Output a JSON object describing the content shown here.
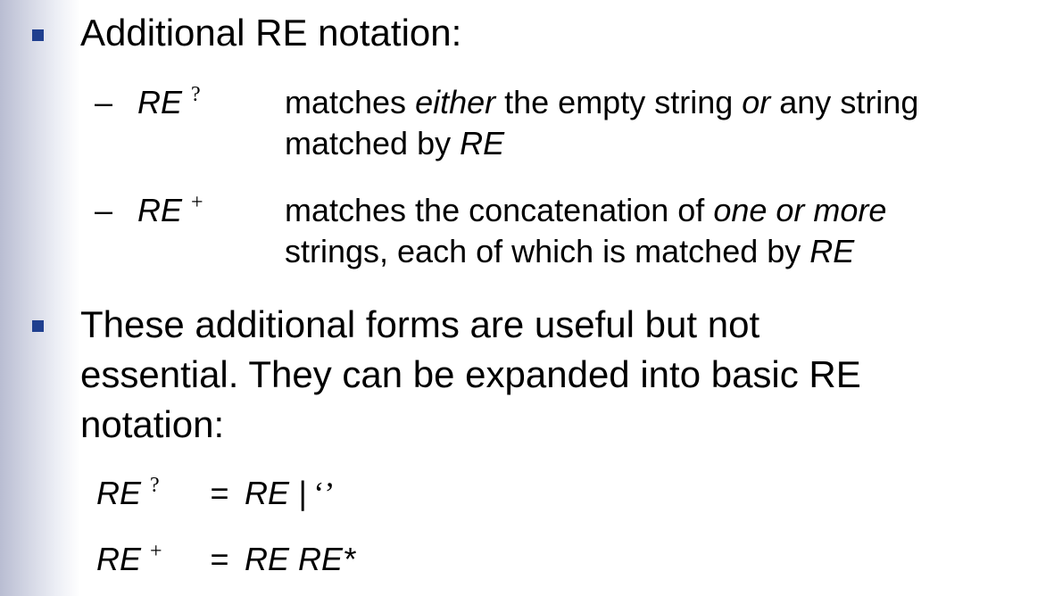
{
  "heading": "Additional RE notation:",
  "items": [
    {
      "dash": "–",
      "term": "RE",
      "symbol": "?",
      "line1_a": "matches ",
      "line1_em1": "either",
      "line1_b": " the empty string ",
      "line1_em2": "or",
      "line1_c": " any string",
      "line2_a": "matched by ",
      "line2_em": "RE"
    },
    {
      "dash": "–",
      "term": "RE",
      "symbol": "+",
      "line1_a": "matches the concatenation of ",
      "line1_em": "one or more",
      "line2_a": "strings, each of which is matched by ",
      "line2_em": "RE"
    }
  ],
  "paragraph": {
    "line1": "These additional forms are useful but not",
    "line2": "essential. They can be expanded into basic RE",
    "line3": "notation:"
  },
  "equations": [
    {
      "lhs": "RE",
      "symbol": "?",
      "op": "=",
      "rhs": "RE |",
      "extra": "‘’"
    },
    {
      "lhs": "RE",
      "symbol": "+",
      "op": "=",
      "rhs": "RE RE*",
      "extra": ""
    }
  ]
}
